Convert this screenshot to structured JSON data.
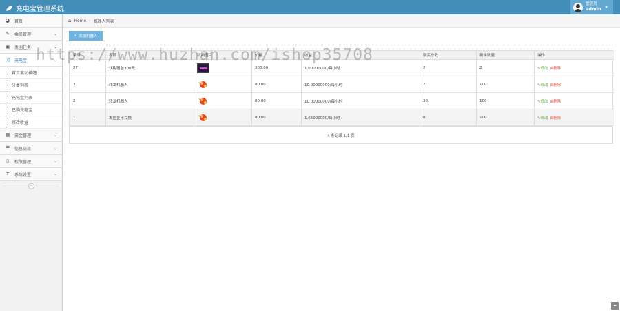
{
  "app": {
    "title": "充电宝管理系统"
  },
  "user": {
    "role": "管理员",
    "name": "admin"
  },
  "sidebar": {
    "items": [
      {
        "label": "首页",
        "icon": "dashboard-icon",
        "glyph": "◕",
        "chevron": false
      },
      {
        "label": "会员管理",
        "icon": "edit-icon",
        "glyph": "✎",
        "chevron": true
      },
      {
        "label": "发圈任务",
        "icon": "tag-icon",
        "glyph": "▣",
        "chevron": true
      },
      {
        "label": "充电宝",
        "icon": "shuffle-icon",
        "glyph": "⤨",
        "chevron": true,
        "active": true
      }
    ],
    "subitems": [
      "首页滚动横幅",
      "分类列表",
      "充电宝列表",
      "已购充电宝",
      "修改收益"
    ],
    "bottom_items": [
      {
        "label": "资金管理",
        "icon": "calendar-icon",
        "glyph": "▦"
      },
      {
        "label": "信息交流",
        "icon": "list-icon",
        "glyph": "☰"
      },
      {
        "label": "权限管理",
        "icon": "file-icon",
        "glyph": "▯"
      },
      {
        "label": "系统设置",
        "icon": "text-icon",
        "glyph": "T"
      }
    ]
  },
  "breadcrumbs": {
    "home": "Home",
    "current": "机器人列表"
  },
  "toolbar": {
    "add_label": "添加机器人"
  },
  "table": {
    "headers": [
      "编号",
      "名称",
      "封面图片",
      "价格",
      "收益",
      "购买总数",
      "剩余数量",
      "操作"
    ],
    "rows": [
      {
        "id": "27",
        "name": "认购赠包300元",
        "img": "screen",
        "price": "300.00",
        "income": "1.00000000/每小时",
        "bought": "2",
        "remain": "2"
      },
      {
        "id": "3",
        "name": "转发机器人",
        "img": "dragon",
        "price": "80.00",
        "income": "10.00000000/每小时",
        "bought": "7",
        "remain": "100"
      },
      {
        "id": "2",
        "name": "转发机器人",
        "img": "dragon",
        "price": "80.00",
        "income": "10.00000000/每小时",
        "bought": "38",
        "remain": "100"
      },
      {
        "id": "1",
        "name": "发圈金币兑换",
        "img": "dragon",
        "price": "80.00",
        "income": "1.65000000/每小时",
        "bought": "0",
        "remain": "100"
      }
    ],
    "edit_label": "修改",
    "delete_label": "删除",
    "pager": "4 条记录 1/1 页"
  },
  "watermark": "https://www.huzhan.com/ishop35708",
  "colors": {
    "topbar": "#438eb9",
    "accent": "#6fb3e0",
    "edit": "#69aa46",
    "delete": "#dd5a43"
  }
}
